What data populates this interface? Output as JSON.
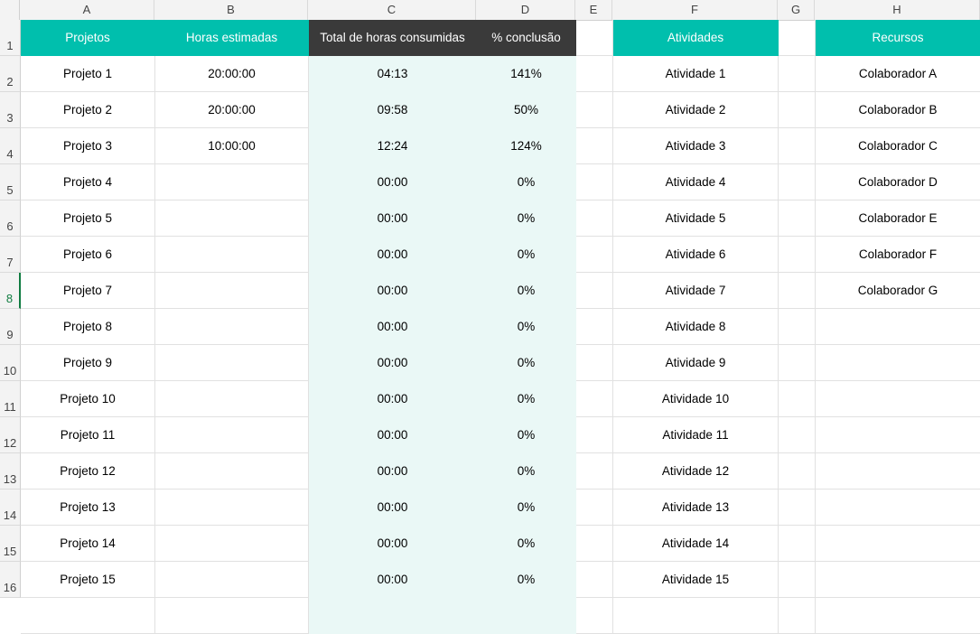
{
  "columns": [
    "A",
    "B",
    "C",
    "D",
    "E",
    "F",
    "G",
    "H"
  ],
  "rows": [
    "1",
    "2",
    "3",
    "4",
    "5",
    "6",
    "7",
    "8",
    "9",
    "10",
    "11",
    "12",
    "13",
    "14",
    "15",
    "16"
  ],
  "selected_row": "8",
  "headers": {
    "projetos": "Projetos",
    "horas_estimadas": "Horas estimadas",
    "total_horas": "Total de horas consumidas",
    "conclusao": "% conclusão",
    "atividades": "Atividades",
    "recursos": "Recursos"
  },
  "projetos": [
    "Projeto 1",
    "Projeto 2",
    "Projeto 3",
    "Projeto 4",
    "Projeto 5",
    "Projeto 6",
    "Projeto 7",
    "Projeto 8",
    "Projeto 9",
    "Projeto 10",
    "Projeto 11",
    "Projeto 12",
    "Projeto 13",
    "Projeto 14",
    "Projeto 15"
  ],
  "horas_estimadas": [
    "20:00:00",
    "20:00:00",
    "10:00:00",
    "",
    "",
    "",
    "",
    "",
    "",
    "",
    "",
    "",
    "",
    "",
    ""
  ],
  "total_horas": [
    "04:13",
    "09:58",
    "12:24",
    "00:00",
    "00:00",
    "00:00",
    "00:00",
    "00:00",
    "00:00",
    "00:00",
    "00:00",
    "00:00",
    "00:00",
    "00:00",
    "00:00"
  ],
  "conclusao": [
    "141%",
    "50%",
    "124%",
    "0%",
    "0%",
    "0%",
    "0%",
    "0%",
    "0%",
    "0%",
    "0%",
    "0%",
    "0%",
    "0%",
    "0%"
  ],
  "atividades": [
    "Atividade 1",
    "Atividade 2",
    "Atividade 3",
    "Atividade 4",
    "Atividade 5",
    "Atividade 6",
    "Atividade 7",
    "Atividade 8",
    "Atividade 9",
    "Atividade 10",
    "Atividade 11",
    "Atividade 12",
    "Atividade 13",
    "Atividade 14",
    "Atividade 15"
  ],
  "recursos": [
    "Colaborador A",
    "Colaborador B",
    "Colaborador C",
    "Colaborador D",
    "Colaborador E",
    "Colaborador F",
    "Colaborador G",
    "",
    "",
    "",
    "",
    "",
    "",
    "",
    ""
  ],
  "colors": {
    "teal": "#00bfad",
    "dark": "#3a3a3a",
    "light_teal": "#eaf8f6",
    "selection": "#107c41"
  }
}
